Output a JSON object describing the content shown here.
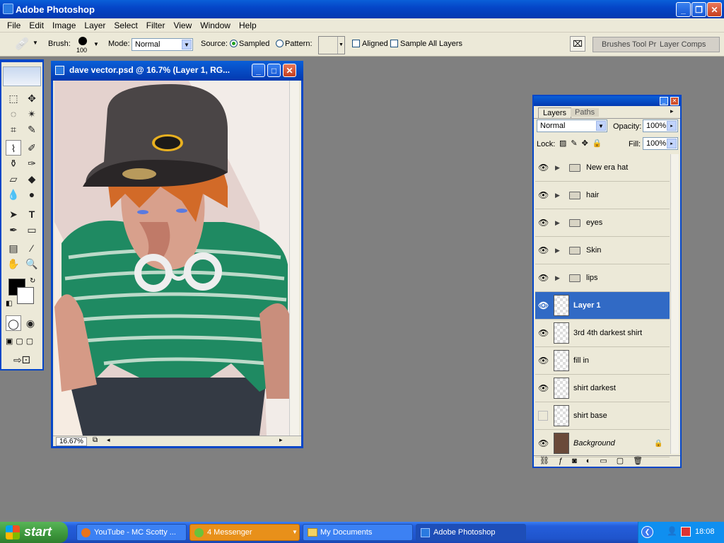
{
  "app": {
    "title": "Adobe Photoshop"
  },
  "menu": [
    "File",
    "Edit",
    "Image",
    "Layer",
    "Select",
    "Filter",
    "View",
    "Window",
    "Help"
  ],
  "options": {
    "brush_label": "Brush:",
    "brush_size": "100",
    "mode_label": "Mode:",
    "mode_value": "Normal",
    "source_label": "Source:",
    "sampled_label": "Sampled",
    "pattern_label": "Pattern:",
    "aligned_label": "Aligned",
    "sample_all_label": "Sample All Layers",
    "well_tabs": [
      "Brushes",
      "Tool Pr",
      "Layer Comps"
    ]
  },
  "document": {
    "title": "dave vector.psd @ 16.7% (Layer 1, RG...",
    "zoom": "16.67%"
  },
  "layers_panel": {
    "tabs": [
      "Layers",
      "Paths"
    ],
    "blend_mode": "Normal",
    "opacity_label": "Opacity:",
    "opacity": "100%",
    "lock_label": "Lock:",
    "fill_label": "Fill:",
    "fill": "100%",
    "layers": [
      {
        "name": "New era hat",
        "type": "group",
        "visible": true
      },
      {
        "name": "hair",
        "type": "group",
        "visible": true
      },
      {
        "name": "eyes",
        "type": "group",
        "visible": true
      },
      {
        "name": "Skin",
        "type": "group",
        "visible": true
      },
      {
        "name": "lips",
        "type": "group",
        "visible": true
      },
      {
        "name": "Layer 1",
        "type": "layer",
        "visible": true,
        "selected": true
      },
      {
        "name": "3rd 4th  darkest shirt",
        "type": "layer",
        "visible": true
      },
      {
        "name": "fill in",
        "type": "layer",
        "visible": true
      },
      {
        "name": "shirt darkest",
        "type": "layer",
        "visible": true
      },
      {
        "name": "shirt base",
        "type": "layer",
        "visible": false
      },
      {
        "name": "Background",
        "type": "background",
        "visible": true,
        "locked": true
      }
    ]
  },
  "taskbar": {
    "start_label": "start",
    "items": [
      "YouTube - MC Scotty ...",
      "4 Messenger",
      "My Documents",
      "Adobe Photoshop"
    ],
    "clock": "18:08"
  },
  "colors": {
    "accent": "#0546c8",
    "selection": "#316ac5",
    "taskbar": "#245edb"
  }
}
